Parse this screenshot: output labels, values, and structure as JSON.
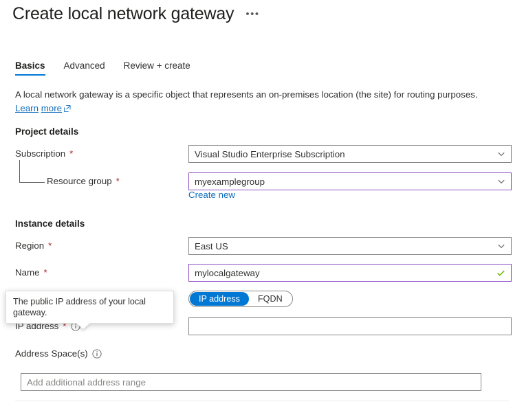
{
  "header": {
    "title": "Create local network gateway",
    "ellipsis": "•••"
  },
  "tabs": [
    {
      "label": "Basics",
      "active": true
    },
    {
      "label": "Advanced",
      "active": false
    },
    {
      "label": "Review + create",
      "active": false
    }
  ],
  "description": {
    "text": "A local network gateway is a specific object that represents an on-premises location (the site) for routing purposes. ",
    "link_part1": "Learn",
    "link_part2": "more",
    "external_icon": "external-link-icon"
  },
  "project_details": {
    "heading": "Project details",
    "subscription": {
      "label": "Subscription",
      "required": "*",
      "value": "Visual Studio Enterprise Subscription",
      "icon": "chevron-down-icon"
    },
    "resource_group": {
      "label": "Resource group",
      "required": "*",
      "value": "myexamplegroup",
      "icon": "chevron-down-icon",
      "create_new": "Create new",
      "focus_color": "#8e4ec6"
    }
  },
  "instance_details": {
    "heading": "Instance details",
    "region": {
      "label": "Region",
      "required": "*",
      "value": "East US",
      "icon": "chevron-down-icon"
    },
    "name": {
      "label": "Name",
      "required": "*",
      "value": "mylocalgateway",
      "icon": "checkmark-icon",
      "valid_color": "#6bb700",
      "focus_color": "#8e4ec6"
    },
    "endpoint_toggle": {
      "options": [
        {
          "label": "IP address",
          "selected": true
        },
        {
          "label": "FQDN",
          "selected": false
        }
      ],
      "selected_color": "#0078d4"
    },
    "ip_address": {
      "label": "IP address",
      "required": "*",
      "info_icon": "info-icon",
      "value": "",
      "tooltip": "The public IP address of your local gateway."
    }
  },
  "address_space": {
    "label": "Address Space(s)",
    "info_icon": "info-icon",
    "placeholder": "Add additional address range",
    "value": ""
  },
  "colors": {
    "accent": "#0078d4",
    "link": "#0f6cbd",
    "required": "#a4262c",
    "focus_border": "#8e4ec6",
    "valid": "#6bb700",
    "border": "#8a8886"
  }
}
